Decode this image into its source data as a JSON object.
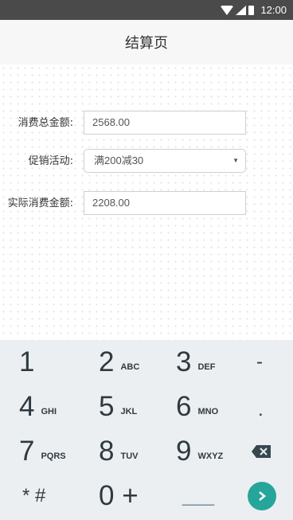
{
  "status_bar": {
    "time": "12:00"
  },
  "header": {
    "title": "结算页"
  },
  "form": {
    "total_label": "消费总金额:",
    "total_value": "2568.00",
    "promo_label": "促销活动:",
    "promo_selected": "满200减30",
    "actual_label": "实际消费金额:",
    "actual_value": "2208.00"
  },
  "keyboard": {
    "rows": [
      [
        {
          "num": "1",
          "letters": ""
        },
        {
          "num": "2",
          "letters": "ABC"
        },
        {
          "num": "3",
          "letters": "DEF"
        }
      ],
      [
        {
          "num": "4",
          "letters": "GHI"
        },
        {
          "num": "5",
          "letters": "JKL"
        },
        {
          "num": "6",
          "letters": "MNO"
        }
      ],
      [
        {
          "num": "7",
          "letters": "PQRS"
        },
        {
          "num": "8",
          "letters": "TUV"
        },
        {
          "num": "9",
          "letters": "WXYZ"
        }
      ]
    ],
    "dash": "-",
    "period": ".",
    "star_hash": "* #",
    "zero_plus": "0 +",
    "space": "___"
  },
  "colors": {
    "status_bar": "#4a4a4a",
    "keyboard_bg": "#eceff1",
    "enter_accent": "#26a69a"
  },
  "icons": [
    "wifi-icon",
    "cell-signal-icon",
    "battery-icon",
    "backspace-icon",
    "chevron-right-icon",
    "dropdown-arrow-icon"
  ]
}
